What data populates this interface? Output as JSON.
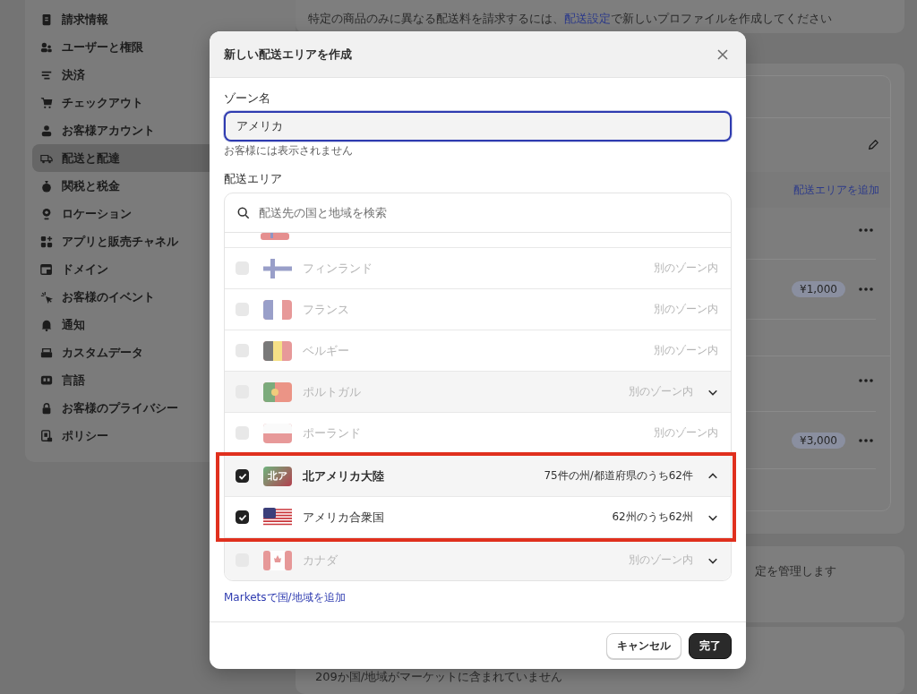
{
  "sidebar": {
    "items": [
      {
        "label": "請求情報",
        "selected": false
      },
      {
        "label": "ユーザーと権限",
        "selected": false
      },
      {
        "label": "決済",
        "selected": false
      },
      {
        "label": "チェックアウト",
        "selected": false
      },
      {
        "label": "お客様アカウント",
        "selected": false
      },
      {
        "label": "配送と配達",
        "selected": true
      },
      {
        "label": "関税と税金",
        "selected": false
      },
      {
        "label": "ロケーション",
        "selected": false
      },
      {
        "label": "アプリと販売チャネル",
        "selected": false
      },
      {
        "label": "ドメイン",
        "selected": false
      },
      {
        "label": "お客様のイベント",
        "selected": false
      },
      {
        "label": "通知",
        "selected": false
      },
      {
        "label": "カスタムデータ",
        "selected": false
      },
      {
        "label": "言語",
        "selected": false
      },
      {
        "label": "お客様のプライバシー",
        "selected": false
      },
      {
        "label": "ポリシー",
        "selected": false
      }
    ]
  },
  "background": {
    "notice": {
      "before": "特定の商品のみに異なる配送料を請求するには、",
      "link": "配送設定",
      "after": "で新しいプロファイルを作成してください"
    },
    "add_area_link": "配送エリアを追加",
    "rates": [
      {
        "kind": "zone"
      },
      {
        "kind": "rate",
        "price": "¥1,000"
      },
      {
        "kind": "zone"
      },
      {
        "kind": "rate",
        "price": "¥3,000"
      }
    ],
    "markets_note": "定を管理します",
    "unlisted_note": "209か国/地域がマーケットに含まれていません"
  },
  "dialog": {
    "title": "新しい配送エリアを作成",
    "zone_name": {
      "label": "ゾーン名",
      "value": "アメリカ",
      "help": "お客様には表示されません"
    },
    "areas": {
      "label": "配送エリア",
      "search": {
        "placeholder": "配送先の国と地域を検索"
      },
      "rows": [
        {
          "name": "フィンランド",
          "status": "別のゾーン内",
          "checked": false,
          "disabled": true,
          "kind": "plain",
          "highlighted": false
        },
        {
          "name": "フランス",
          "status": "別のゾーン内",
          "checked": false,
          "disabled": true,
          "kind": "plain",
          "highlighted": false
        },
        {
          "name": "ベルギー",
          "status": "別のゾーン内",
          "checked": false,
          "disabled": true,
          "kind": "plain",
          "highlighted": false
        },
        {
          "name": "ポルトガル",
          "status": "別のゾーン内",
          "checked": false,
          "disabled": true,
          "kind": "group",
          "expanded": false,
          "highlighted": false
        },
        {
          "name": "ポーランド",
          "status": "別のゾーン内",
          "checked": false,
          "disabled": true,
          "kind": "plain",
          "highlighted": false
        },
        {
          "name": "北アメリカ大陸",
          "badge": "北ア",
          "status": "75件の州/都道府県のうち62件",
          "checked": true,
          "disabled": false,
          "kind": "continent",
          "expanded": true,
          "highlighted": true
        },
        {
          "name": "アメリカ合衆国",
          "status": "62州のうち62州",
          "checked": true,
          "disabled": false,
          "kind": "expandable",
          "expanded": false,
          "highlighted": true
        },
        {
          "name": "カナダ",
          "status": "別のゾーン内",
          "checked": false,
          "disabled": true,
          "kind": "group",
          "expanded": false,
          "highlighted": false
        }
      ]
    },
    "markets_link": "Marketsで国/地域を追加",
    "buttons": [
      {
        "label": "キャンセル",
        "kind": "secondary"
      },
      {
        "label": "完了",
        "kind": "primary"
      }
    ]
  }
}
